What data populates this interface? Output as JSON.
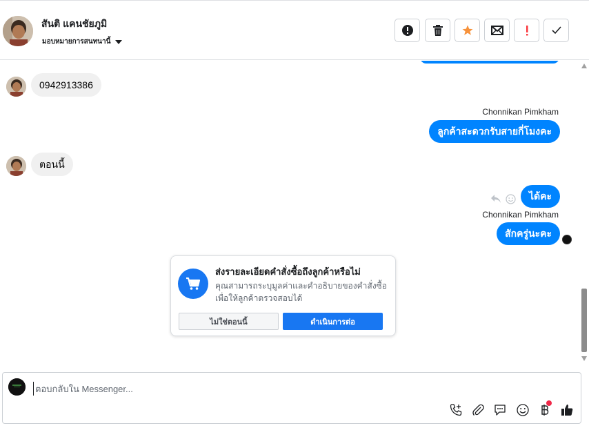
{
  "header": {
    "contact_name": "สันติ แคนชัยภูมิ",
    "assign_label": "มอบหมายการสนทนานี้",
    "actions": [
      {
        "name": "report-spam-button",
        "icon": "alert-circle-icon"
      },
      {
        "name": "delete-button",
        "icon": "trash-icon"
      },
      {
        "name": "star-button",
        "icon": "star-icon",
        "color": "#f7923b"
      },
      {
        "name": "mark-unread-button",
        "icon": "envelope-icon"
      },
      {
        "name": "priority-button",
        "icon": "exclamation-icon",
        "color": "#fa383e"
      },
      {
        "name": "mark-done-button",
        "icon": "check-icon"
      }
    ]
  },
  "messages": [
    {
      "from": "customer",
      "text": "0942913386"
    },
    {
      "from": "page",
      "sender": "Chonnikan Pimkham",
      "text": "ลูกค้าสะดวกรับสายกี่โมงคะ"
    },
    {
      "from": "customer",
      "text": "ตอนนี้"
    },
    {
      "from": "page",
      "text": "ได้คะ"
    },
    {
      "from": "page",
      "sender": "Chonnikan Pimkham",
      "text": "สักครู่นะคะ"
    }
  ],
  "order_card": {
    "title": "ส่งรายละเอียดคำสั่งซื้อถึงลูกค้าหรือไม่",
    "description": "คุณสามารถระบุมูลค่าและคำอธิบายของคำสั่งซื้อเพื่อให้ลูกค้าตรวจสอบได้",
    "not_now_label": "ไม่ใช่ตอนนี้",
    "continue_label": "ดำเนินการต่อ"
  },
  "composer": {
    "placeholder": "ตอบกลับใน Messenger...",
    "tools": [
      "call-add-icon",
      "paperclip-icon",
      "saved-reply-icon",
      "emoji-icon",
      "baht-payment-icon",
      "thumbs-up-icon"
    ]
  },
  "colors": {
    "accent": "#0084ff",
    "button_blue": "#1877f2",
    "star": "#f7923b",
    "priority": "#fa383e"
  }
}
